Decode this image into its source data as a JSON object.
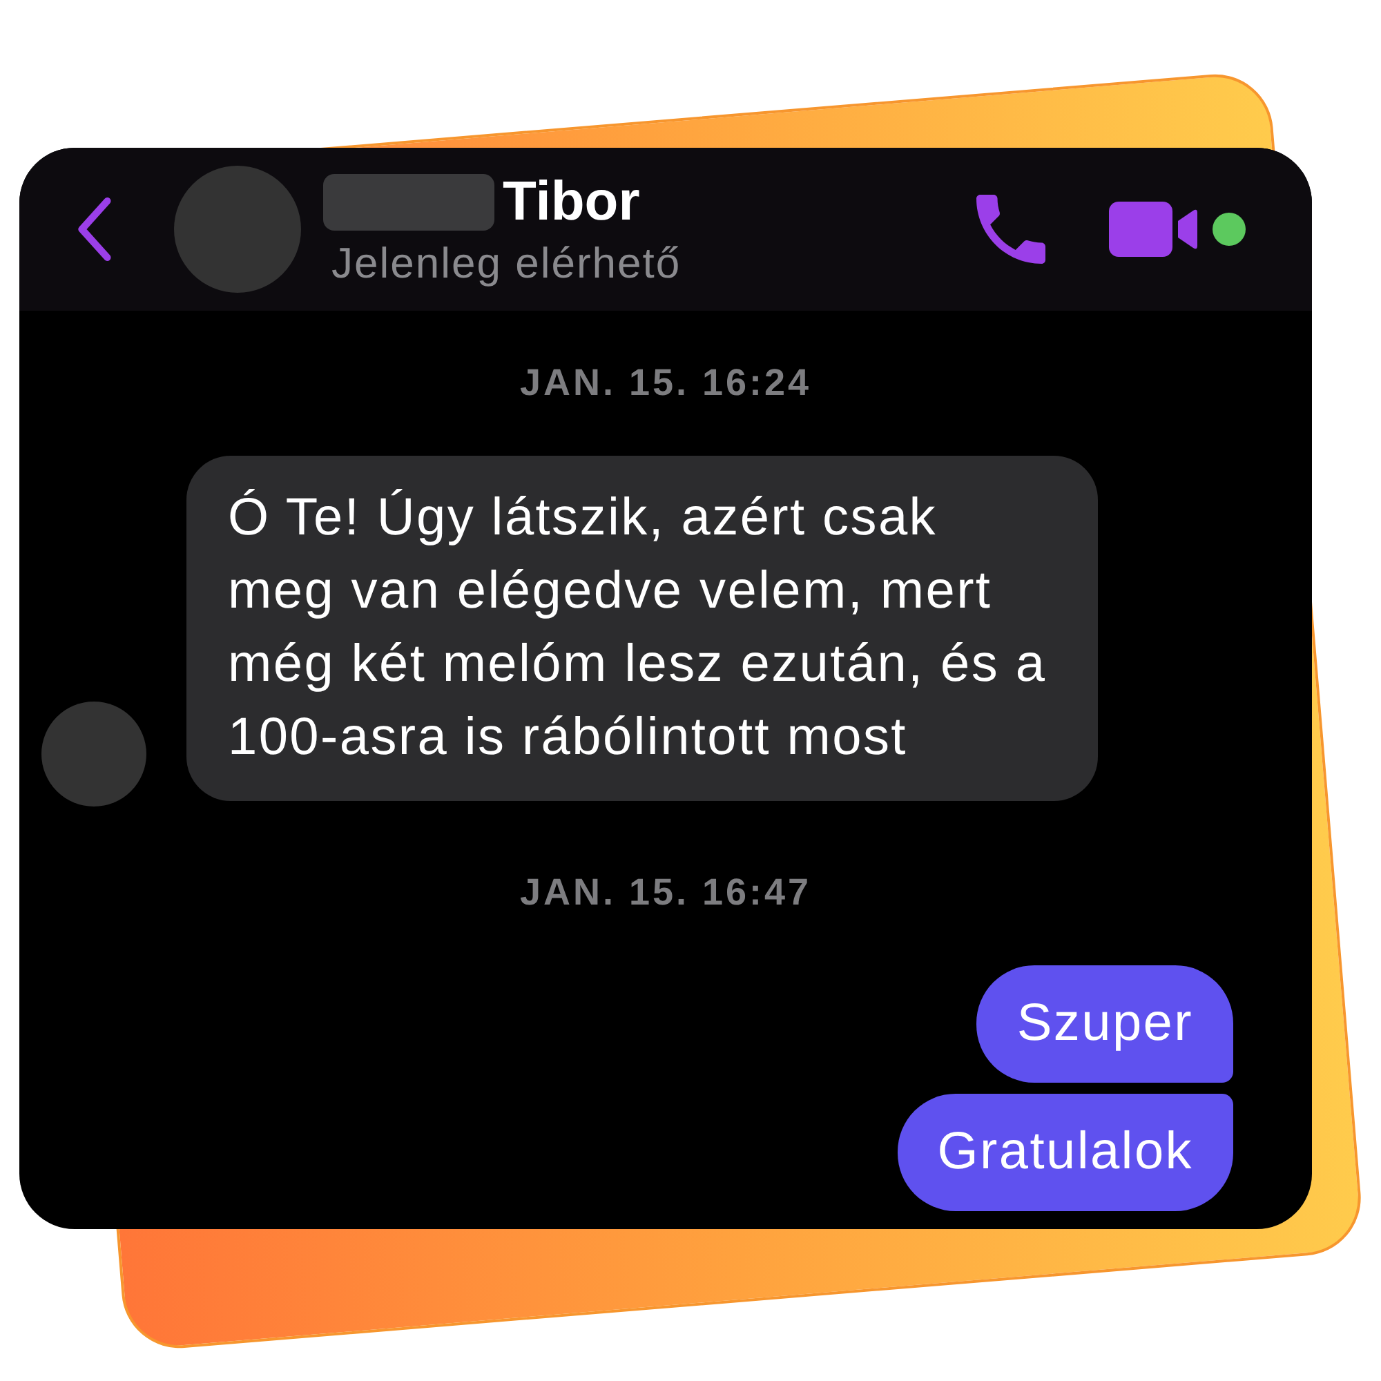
{
  "contact": {
    "name": "Tibor",
    "status": "Jelenleg elérhető",
    "online": true
  },
  "messages": [
    {
      "kind": "timestamp",
      "text": "JAN. 15. 16:24"
    },
    {
      "kind": "incoming",
      "text": "Ó Te! Úgy látszik, azért csak meg van elégedve velem, mert még két melóm lesz ezután, és a 100-asra is rábólintott most",
      "show_avatar": true
    },
    {
      "kind": "timestamp",
      "text": "JAN. 15. 16:47"
    },
    {
      "kind": "outgoing",
      "text": "Szuper"
    },
    {
      "kind": "outgoing",
      "text": "Gratulalok"
    }
  ]
}
